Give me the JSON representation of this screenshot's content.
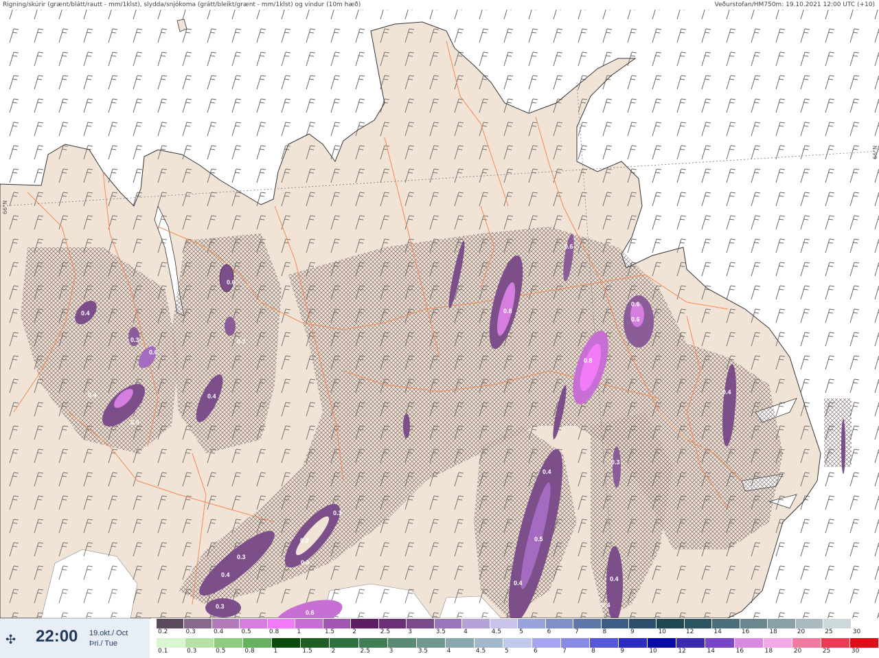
{
  "header": {
    "title": "Rigning/skúrir (grænt/blátt/rautt - mm/1klst), slydda/snjókoma (grátt/bleikt/grænt - mm/1klst) og vindur (10m hæð)",
    "source": "Veðurstofan/HM750m: 19.10.2021 12:00 UTC (+10)"
  },
  "latitude_labels": [
    "66°N",
    "66°N"
  ],
  "time": {
    "value": "22:00",
    "date_line1": "19.okt./ Oct",
    "date_line2": "Þri./ Tue"
  },
  "legend": {
    "snow": {
      "labels": [
        "0.2",
        "0.3",
        "0.4",
        "0.5",
        "0.8",
        "1",
        "1.5",
        "2",
        "2.5",
        "3",
        "3.5",
        "4",
        "4.5",
        "5",
        "6",
        "7",
        "8",
        "9",
        "10",
        "12",
        "14",
        "16",
        "18",
        "20",
        "25",
        "30"
      ],
      "colors": [
        "#5b4a5c",
        "#8a6a8c",
        "#b27ab8",
        "#d57ee0",
        "#f27cf7",
        "#c86fd6",
        "#a056b0",
        "#5e1c62",
        "#6a2f75",
        "#7a4b8a",
        "#9a75b9",
        "#b4a3d8",
        "#c9c4ec",
        "#9aa4dc",
        "#7f8fc8",
        "#5f77a8",
        "#3e5d85",
        "#2c4e6a",
        "#1e4750",
        "#2b5560",
        "#4b6e78",
        "#6a8790",
        "#8aa0a6",
        "#aabbbf",
        "#ccd8da",
        "#ffffff"
      ]
    },
    "rain": {
      "labels": [
        "0.1",
        "0.3",
        "0.5",
        "0.8",
        "1",
        "1.5",
        "2",
        "2.5",
        "3",
        "3.5",
        "4",
        "4.5",
        "5",
        "6",
        "7",
        "8",
        "9",
        "10",
        "12",
        "14",
        "16",
        "18",
        "20",
        "25",
        "30"
      ],
      "colors": [
        "#d9f5d2",
        "#b6e2a8",
        "#8fcc82",
        "#66b15f",
        "#0a4a0a",
        "#1f5e25",
        "#2f7040",
        "#417d55",
        "#5a8a73",
        "#6f9890",
        "#88a8ae",
        "#a4b8cc",
        "#c2caec",
        "#a6a6f0",
        "#8a8ae8",
        "#5656d8",
        "#2b2bc2",
        "#0a0aa8",
        "#3a2ab0",
        "#7a46c8",
        "#d98ae0",
        "#f4a8e8",
        "#f07aa0",
        "#ea3a56",
        "#e00c1a"
      ]
    },
    "colors": {
      "land": "#f1e3d6",
      "sea": "#ffffff",
      "coast": "#333333",
      "roads": "#f08a58",
      "snow_area": "#e8d8f0"
    }
  }
}
